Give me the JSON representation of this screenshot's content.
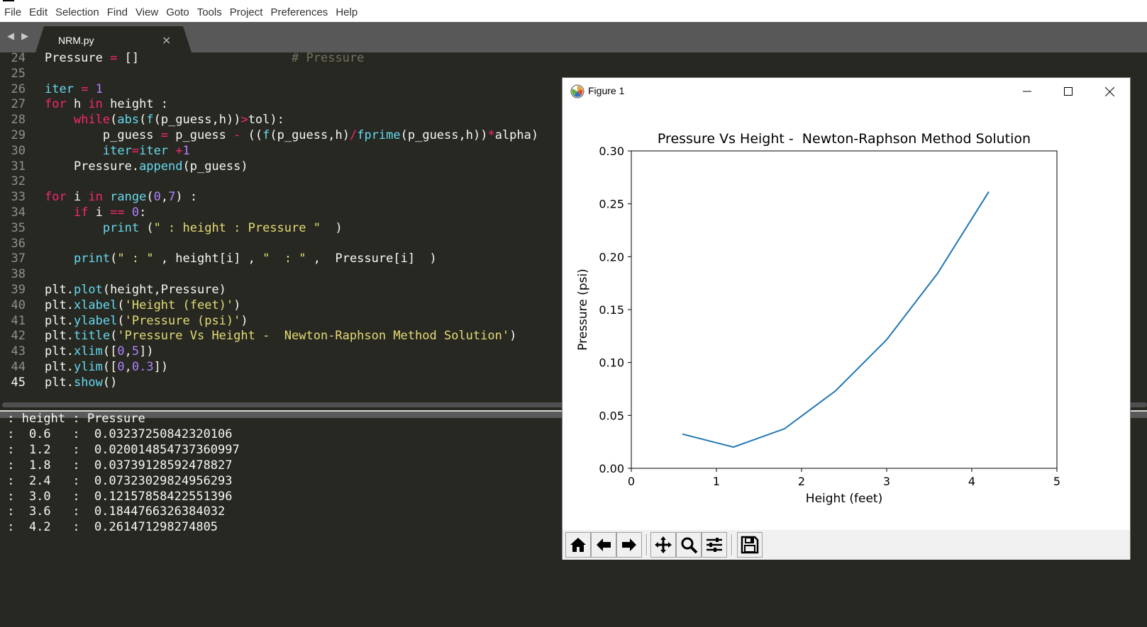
{
  "menu": [
    "File",
    "Edit",
    "Selection",
    "Find",
    "View",
    "Goto",
    "Tools",
    "Project",
    "Preferences",
    "Help"
  ],
  "tab": {
    "name": "NRM.py",
    "close": "×"
  },
  "nav_arrows": "◀ ▶",
  "code_lines": [
    {
      "n": "24",
      "tokens": [
        [
          "Pressure ",
          ""
        ],
        [
          "=",
          "kw"
        ],
        [
          " []",
          ""
        ],
        [
          "                     # Pressure",
          "cm"
        ]
      ]
    },
    {
      "n": "25",
      "tokens": []
    },
    {
      "n": "26",
      "tokens": [
        [
          "iter",
          "bi"
        ],
        [
          " ",
          ""
        ],
        [
          "=",
          "kw"
        ],
        [
          " ",
          ""
        ],
        [
          "1",
          "num"
        ]
      ]
    },
    {
      "n": "27",
      "tokens": [
        [
          "for",
          "kw"
        ],
        [
          " h ",
          ""
        ],
        [
          "in",
          "kw"
        ],
        [
          " height :",
          ""
        ]
      ]
    },
    {
      "n": "28",
      "tokens": [
        [
          "    ",
          ""
        ],
        [
          "while",
          "kw"
        ],
        [
          "(",
          ""
        ],
        [
          "abs",
          "bi"
        ],
        [
          "(",
          ""
        ],
        [
          "f",
          "bi"
        ],
        [
          "(p_guess,h))",
          ""
        ],
        [
          ">",
          "kw"
        ],
        [
          "tol):",
          ""
        ]
      ]
    },
    {
      "n": "29",
      "tokens": [
        [
          "        p_guess ",
          ""
        ],
        [
          "=",
          "kw"
        ],
        [
          " p_guess ",
          ""
        ],
        [
          "-",
          "kw"
        ],
        [
          " ((",
          ""
        ],
        [
          "f",
          "bi"
        ],
        [
          "(p_guess,h)",
          ""
        ],
        [
          "/",
          "kw"
        ],
        [
          "fprime",
          "bi"
        ],
        [
          "(p_guess,h))",
          ""
        ],
        [
          "*",
          "kw"
        ],
        [
          "alpha)",
          ""
        ]
      ]
    },
    {
      "n": "30",
      "tokens": [
        [
          "        ",
          ""
        ],
        [
          "iter",
          "bi"
        ],
        [
          "=",
          "kw"
        ],
        [
          "iter",
          "bi"
        ],
        [
          " ",
          ""
        ],
        [
          "+",
          "kw"
        ],
        [
          "1",
          "num"
        ]
      ]
    },
    {
      "n": "31",
      "tokens": [
        [
          "    Pressure.",
          ""
        ],
        [
          "append",
          "bi"
        ],
        [
          "(p_guess)",
          ""
        ]
      ]
    },
    {
      "n": "32",
      "tokens": []
    },
    {
      "n": "33",
      "tokens": [
        [
          "for",
          "kw"
        ],
        [
          " i ",
          ""
        ],
        [
          "in",
          "kw"
        ],
        [
          " ",
          ""
        ],
        [
          "range",
          "bi"
        ],
        [
          "(",
          ""
        ],
        [
          "0",
          "num"
        ],
        [
          ",",
          ""
        ],
        [
          "7",
          "num"
        ],
        [
          ") :",
          ""
        ]
      ]
    },
    {
      "n": "34",
      "tokens": [
        [
          "    ",
          ""
        ],
        [
          "if",
          "kw"
        ],
        [
          " i ",
          ""
        ],
        [
          "==",
          "kw"
        ],
        [
          " ",
          ""
        ],
        [
          "0",
          "num"
        ],
        [
          ":",
          ""
        ]
      ]
    },
    {
      "n": "35",
      "tokens": [
        [
          "        ",
          ""
        ],
        [
          "print",
          "bi"
        ],
        [
          " (",
          ""
        ],
        [
          "\" : height : Pressure \"",
          "str"
        ],
        [
          "  )",
          ""
        ]
      ]
    },
    {
      "n": "36",
      "tokens": []
    },
    {
      "n": "37",
      "tokens": [
        [
          "    ",
          ""
        ],
        [
          "print",
          "bi"
        ],
        [
          "(",
          ""
        ],
        [
          "\" : \"",
          "str"
        ],
        [
          " , height[i] , ",
          ""
        ],
        [
          "\"  : \"",
          "str"
        ],
        [
          " ,  Pressure[i]  )",
          ""
        ]
      ]
    },
    {
      "n": "38",
      "tokens": []
    },
    {
      "n": "39",
      "tokens": [
        [
          "plt.",
          ""
        ],
        [
          "plot",
          "bi"
        ],
        [
          "(height,Pressure)",
          ""
        ]
      ]
    },
    {
      "n": "40",
      "tokens": [
        [
          "plt.",
          ""
        ],
        [
          "xlabel",
          "bi"
        ],
        [
          "(",
          ""
        ],
        [
          "'Height (feet)'",
          "str"
        ],
        [
          ")",
          ""
        ]
      ]
    },
    {
      "n": "41",
      "tokens": [
        [
          "plt.",
          ""
        ],
        [
          "ylabel",
          "bi"
        ],
        [
          "(",
          ""
        ],
        [
          "'Pressure (psi)'",
          "str"
        ],
        [
          ")",
          ""
        ]
      ]
    },
    {
      "n": "42",
      "tokens": [
        [
          "plt.",
          ""
        ],
        [
          "title",
          "bi"
        ],
        [
          "(",
          ""
        ],
        [
          "'Pressure Vs Height -  Newton-Raphson Method Solution'",
          "str"
        ],
        [
          ")",
          ""
        ]
      ]
    },
    {
      "n": "43",
      "tokens": [
        [
          "plt.",
          ""
        ],
        [
          "xlim",
          "bi"
        ],
        [
          "([",
          ""
        ],
        [
          "0",
          "num"
        ],
        [
          ",",
          ""
        ],
        [
          "5",
          "num"
        ],
        [
          "])",
          ""
        ]
      ]
    },
    {
      "n": "44",
      "tokens": [
        [
          "plt.",
          ""
        ],
        [
          "ylim",
          "bi"
        ],
        [
          "([",
          ""
        ],
        [
          "0",
          "num"
        ],
        [
          ",",
          ""
        ],
        [
          "0.3",
          "num"
        ],
        [
          "])",
          ""
        ]
      ]
    },
    {
      "n": "45",
      "tokens": [
        [
          "plt.",
          ""
        ],
        [
          "show",
          "bi"
        ],
        [
          "()",
          ""
        ]
      ],
      "current": true
    }
  ],
  "output_lines": [
    " : height : Pressure",
    " :  0.6   :  0.03237250842320106",
    " :  1.2   :  0.020014854737360997",
    " :  1.8   :  0.03739128592478827",
    " :  2.4   :  0.07323029824956293",
    " :  3.0   :  0.12157858422551396",
    " :  3.6   :  0.1844766326384032",
    " :  4.2   :  0.261471298274805"
  ],
  "figure": {
    "window_title": "Figure 1",
    "toolbar_icons": [
      "home-icon",
      "back-arrow-icon",
      "forward-arrow-icon",
      "pan-icon",
      "zoom-icon",
      "configure-subplots-icon",
      "save-icon"
    ]
  },
  "chart_data": {
    "type": "line",
    "title": "Pressure Vs Height -  Newton-Raphson Method Solution",
    "xlabel": "Height (feet)",
    "ylabel": "Pressure (psi)",
    "xlim": [
      0,
      5
    ],
    "ylim": [
      0,
      0.3
    ],
    "xticks": [
      "0",
      "1",
      "2",
      "3",
      "4",
      "5"
    ],
    "yticks": [
      "0.00",
      "0.05",
      "0.10",
      "0.15",
      "0.20",
      "0.25",
      "0.30"
    ],
    "series": [
      {
        "x": [
          0.6,
          1.2,
          1.8,
          2.4,
          3.0,
          3.6,
          4.2
        ],
        "y": [
          0.03237250842320106,
          0.020014854737360997,
          0.03739128592478827,
          0.07323029824956293,
          0.12157858422551396,
          0.1844766326384032,
          0.261471298274805
        ],
        "color": "#1f77b4"
      }
    ],
    "grid": false,
    "legend": "none"
  }
}
